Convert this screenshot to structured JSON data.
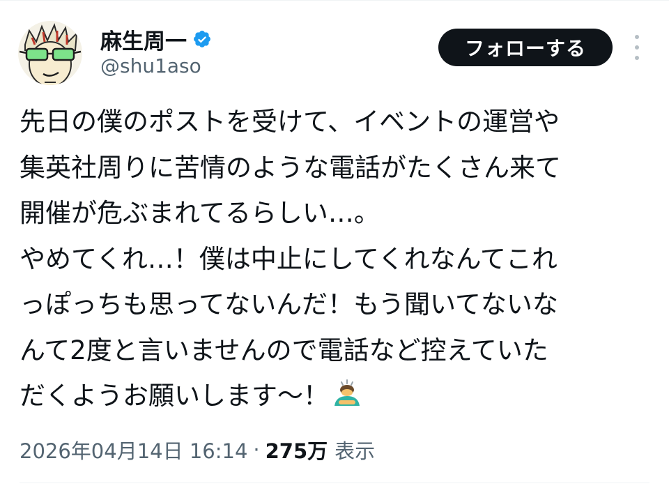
{
  "user": {
    "display_name": "麻生周一",
    "handle": "@shu1aso",
    "verified_icon": "verified-badge-icon",
    "avatar_icon": "avatar-icon"
  },
  "follow_button": {
    "label": "フォローする"
  },
  "more_menu": {
    "icon": "more-vertical-icon"
  },
  "tweet": {
    "lines": [
      "先日の僕のポストを受けて、イベントの運営や",
      "集英社周りに苦情のような電話がたくさん来て",
      "開催が危ぶまれてるらしい…。",
      "やめてくれ…！僕は中止にしてくれなんてこれ",
      "っぽっちも思ってないんだ！もう聞いてないな",
      "んて2度と言いませんので電話など控えていた",
      "だくようお願いします〜！"
    ],
    "trailing_emoji": "person-bowing-emoji"
  },
  "meta": {
    "timestamp": "2026年04月14日 16:14",
    "separator": "·",
    "views_count": "275万",
    "views_label": "表示"
  },
  "colors": {
    "text_primary": "#0f1419",
    "text_secondary": "#536471",
    "verified_blue": "#1d9bf0",
    "follow_button_bg": "#0f1419",
    "divider": "#eff3f4"
  }
}
